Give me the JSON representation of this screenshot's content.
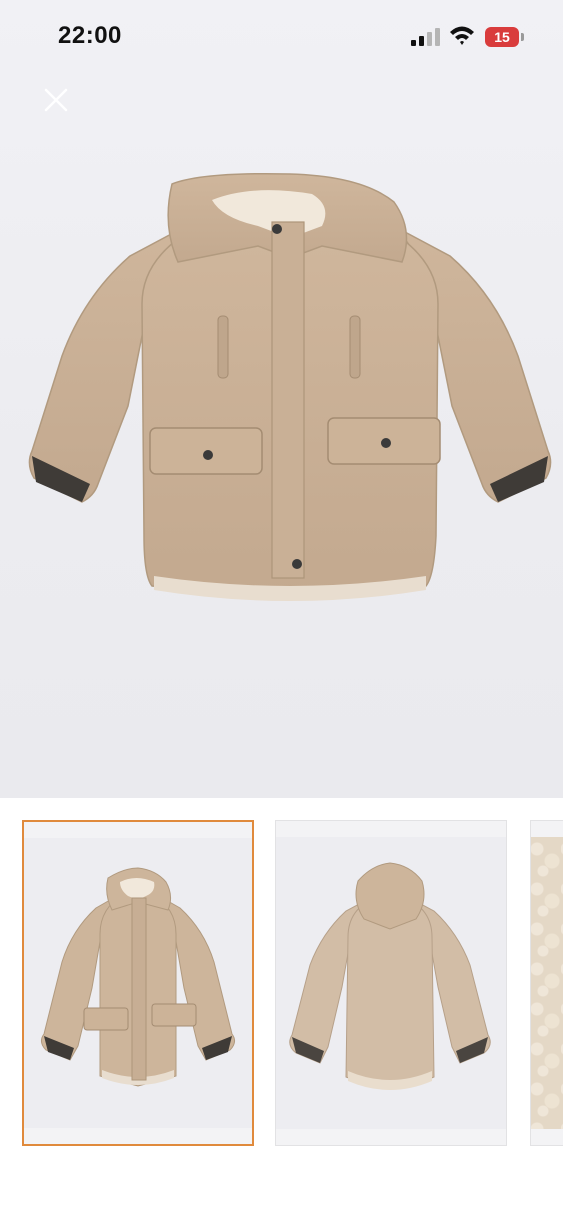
{
  "status_bar": {
    "time": "22:00",
    "battery_level": "15",
    "battery_color": "#d93c3c",
    "icons": [
      "signal-icon",
      "wifi-icon",
      "battery-icon"
    ]
  },
  "hero": {
    "close_icon": "close-icon",
    "image": "jacket-front-image"
  },
  "thumbnails": {
    "selected_index": 0,
    "accent_color": "#e08a3c",
    "items": [
      {
        "image": "jacket-front-thumbnail"
      },
      {
        "image": "jacket-back-thumbnail"
      },
      {
        "image": "fleece-lining-thumbnail"
      }
    ]
  }
}
